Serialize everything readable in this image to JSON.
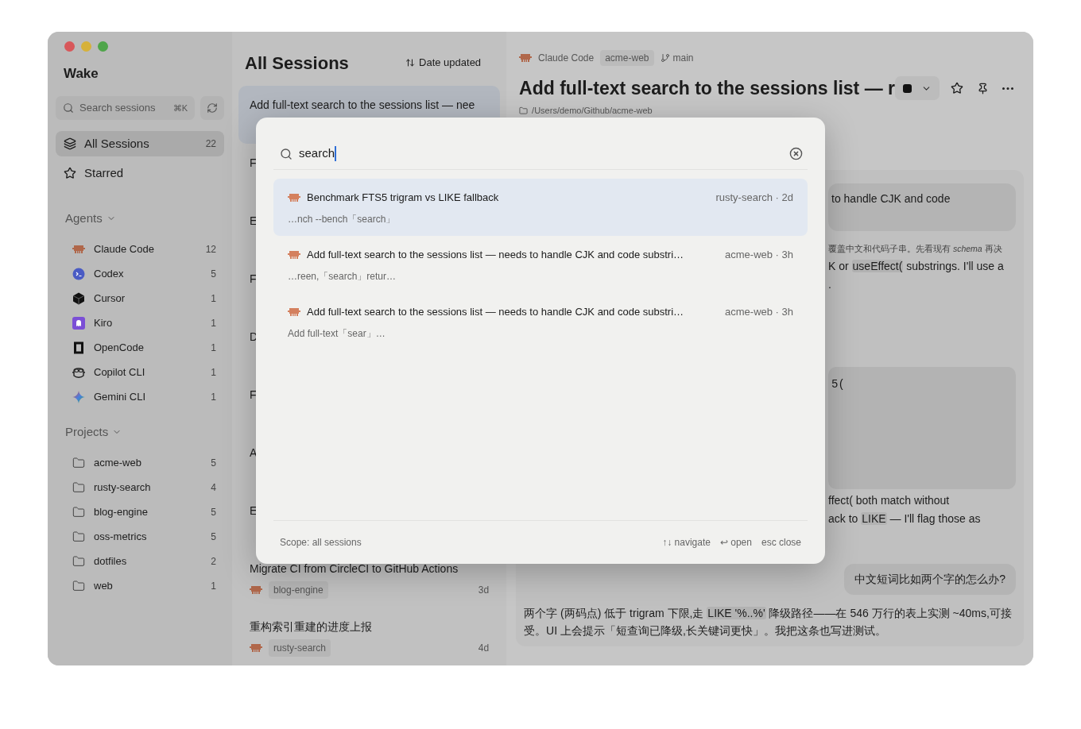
{
  "sidebar": {
    "app_title": "Wake",
    "search": {
      "placeholder": "Search sessions",
      "shortcut": "⌘K"
    },
    "nav": [
      {
        "label": "All Sessions",
        "count": "22",
        "kind": "layers",
        "selected": true
      },
      {
        "label": "Starred",
        "kind": "star",
        "selected": false
      }
    ],
    "agents": {
      "heading": "Agents",
      "expanded": true,
      "items": [
        {
          "name": "Claude Code",
          "count": "12",
          "kind": "claude"
        },
        {
          "name": "Codex",
          "count": "5",
          "kind": "codex"
        },
        {
          "name": "Cursor",
          "count": "1",
          "kind": "cursor"
        },
        {
          "name": "Kiro",
          "count": "1",
          "kind": "kiro"
        },
        {
          "name": "OpenCode",
          "count": "1",
          "kind": "opencode"
        },
        {
          "name": "Copilot CLI",
          "count": "1",
          "kind": "copilot"
        },
        {
          "name": "Gemini CLI",
          "count": "1",
          "kind": "gemini"
        }
      ]
    },
    "projects": {
      "heading": "Projects",
      "expanded": true,
      "items": [
        {
          "name": "acme-web",
          "count": "5"
        },
        {
          "name": "rusty-search",
          "count": "4"
        },
        {
          "name": "blog-engine",
          "count": "5"
        },
        {
          "name": "oss-metrics",
          "count": "5"
        },
        {
          "name": "dotfiles",
          "count": "2"
        },
        {
          "name": "web",
          "count": "1"
        }
      ]
    }
  },
  "sessions": {
    "title": "All Sessions",
    "sort": "Date updated",
    "items": [
      {
        "title": "Add full-text search to the sessions list — nee",
        "selected": true
      },
      {
        "title": "F",
        "selected": false
      },
      {
        "title": "E",
        "selected": false
      },
      {
        "title": "F",
        "selected": false
      },
      {
        "title": "D",
        "selected": false
      },
      {
        "title": "F",
        "selected": false
      },
      {
        "title": "A",
        "selected": false
      },
      {
        "title": "E",
        "selected": false
      },
      {
        "title": "Migrate CI from CircleCI to GitHub Actions",
        "selected": false,
        "agent": {
          "kind": "claude"
        },
        "project": "blog-engine",
        "age": "3d"
      },
      {
        "title": "重构索引重建的进度上报",
        "selected": false,
        "agent": {
          "kind": "claude"
        },
        "project": "rusty-search",
        "age": "4d"
      }
    ]
  },
  "detail": {
    "agent": "Claude Code",
    "agent_icon": {
      "kind": "claude"
    },
    "project": "acme-web",
    "branch": "main",
    "title": "Add full-text search to the sessions list — r",
    "path": "/Users/demo/Github/acme-web",
    "fragments": [
      {
        "kind": "bubble",
        "text": "to handle CJK and code"
      },
      {
        "kind": "note",
        "text": "覆盖中文和代码子串。先看现有 *schema* 再决"
      },
      {
        "kind": "line",
        "segments": [
          {
            "kind": "text",
            "text": "K or "
          },
          {
            "kind": "code",
            "text": "useEffect("
          },
          {
            "kind": "text",
            "text": " substrings. I'll use a"
          }
        ]
      },
      {
        "kind": "line",
        "segments": [
          {
            "kind": "text",
            "text": "."
          }
        ]
      },
      {
        "kind": "codeblock",
        "text": "5("
      },
      {
        "kind": "line",
        "segments": [
          {
            "kind": "text",
            "text": "ffect( both match without"
          }
        ]
      },
      {
        "kind": "line",
        "segments": [
          {
            "kind": "text",
            "text": "ack to "
          },
          {
            "kind": "code",
            "text": "LIKE"
          },
          {
            "kind": "text",
            "text": " — I'll flag those as"
          }
        ]
      }
    ],
    "question": "中文短词比如两个字的怎么办?",
    "answer": [
      {
        "kind": "text",
        "text": "两个字 (两码点) 低于 trigram 下限,走 "
      },
      {
        "kind": "code",
        "text": "LIKE '%..%'"
      },
      {
        "kind": "text",
        "text": " 降级路径——在 546 万行的表上实测 ~40ms,可接受。UI 上会提示「短查询已降级,长关键词更快」。我把这条也写进测试。"
      }
    ]
  },
  "palette": {
    "query": "search",
    "results": [
      {
        "title": "Benchmark FTS5 trigram vs LIKE fallback",
        "meta": "rusty-search · 2d",
        "snippet": "…nch --bench「search」",
        "selected": true
      },
      {
        "title": "Add full-text search to the sessions list — needs to handle CJK and code substri…",
        "meta": "acme-web · 3h",
        "snippet": "…reen,「search」retur…",
        "selected": false
      },
      {
        "title": "Add full-text search to the sessions list — needs to handle CJK and code substri…",
        "meta": "acme-web · 3h",
        "snippet": "Add full-text「sear」…",
        "selected": false
      }
    ],
    "scope": "Scope: all sessions",
    "hints": [
      {
        "keys": "↑↓",
        "label": "navigate"
      },
      {
        "keys": "↩",
        "label": "open"
      },
      {
        "keys": "esc",
        "label": "close"
      }
    ]
  }
}
